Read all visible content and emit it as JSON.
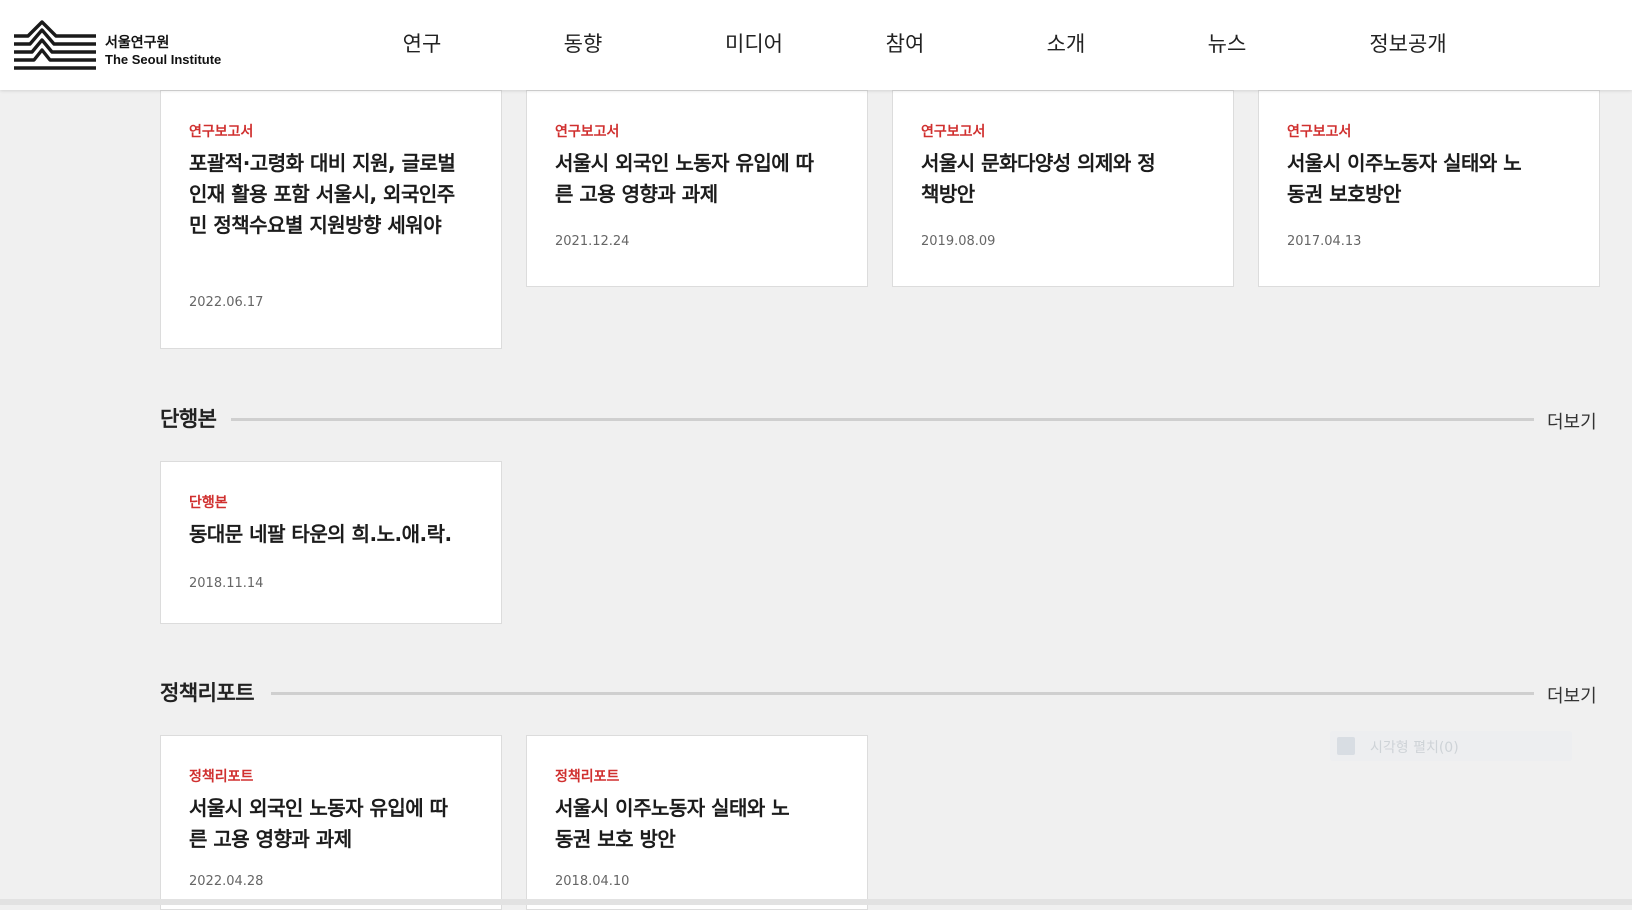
{
  "header": {
    "logo_ko": "서울연구원",
    "logo_en": "The Seoul Institute",
    "nav": [
      "연구",
      "동향",
      "미디어",
      "참여",
      "소개",
      "뉴스",
      "정보공개"
    ]
  },
  "reports": [
    {
      "category": "연구보고서",
      "title": "포괄적·고령화 대비 지원, 글로벌 인재 활용 포함 서울시, 외국인주민 정책수요별 지원방향 세워야",
      "date": "2022.06.17"
    },
    {
      "category": "연구보고서",
      "title": "서울시 외국인 노동자 유입에 따른 고용 영향과 과제",
      "date": "2021.12.24"
    },
    {
      "category": "연구보고서",
      "title": "서울시 문화다양성 의제와 정책방안",
      "date": "2019.08.09"
    },
    {
      "category": "연구보고서",
      "title": "서울시 이주노동자 실태와 노동권 보호방안",
      "date": "2017.04.13"
    }
  ],
  "sections": {
    "books": {
      "title": "단행본",
      "more": "더보기",
      "items": [
        {
          "category": "단행본",
          "title": "동대문 네팔 타운의 희.노.애.락.",
          "date": "2018.11.14"
        }
      ]
    },
    "policy": {
      "title": "정책리포트",
      "more": "더보기",
      "items": [
        {
          "category": "정책리포트",
          "title": "서울시 외국인 노동자 유입에 따른 고용 영향과 과제",
          "date": "2022.04.28"
        },
        {
          "category": "정책리포트",
          "title": "서울시 이주노동자 실태와 노동권 보호 방안",
          "date": "2018.04.10"
        }
      ]
    }
  },
  "floating_widget": {
    "label": "시각형 펼치(0)"
  },
  "colors": {
    "accent": "#d0302f",
    "background": "#f0f0f0",
    "card": "#ffffff"
  }
}
